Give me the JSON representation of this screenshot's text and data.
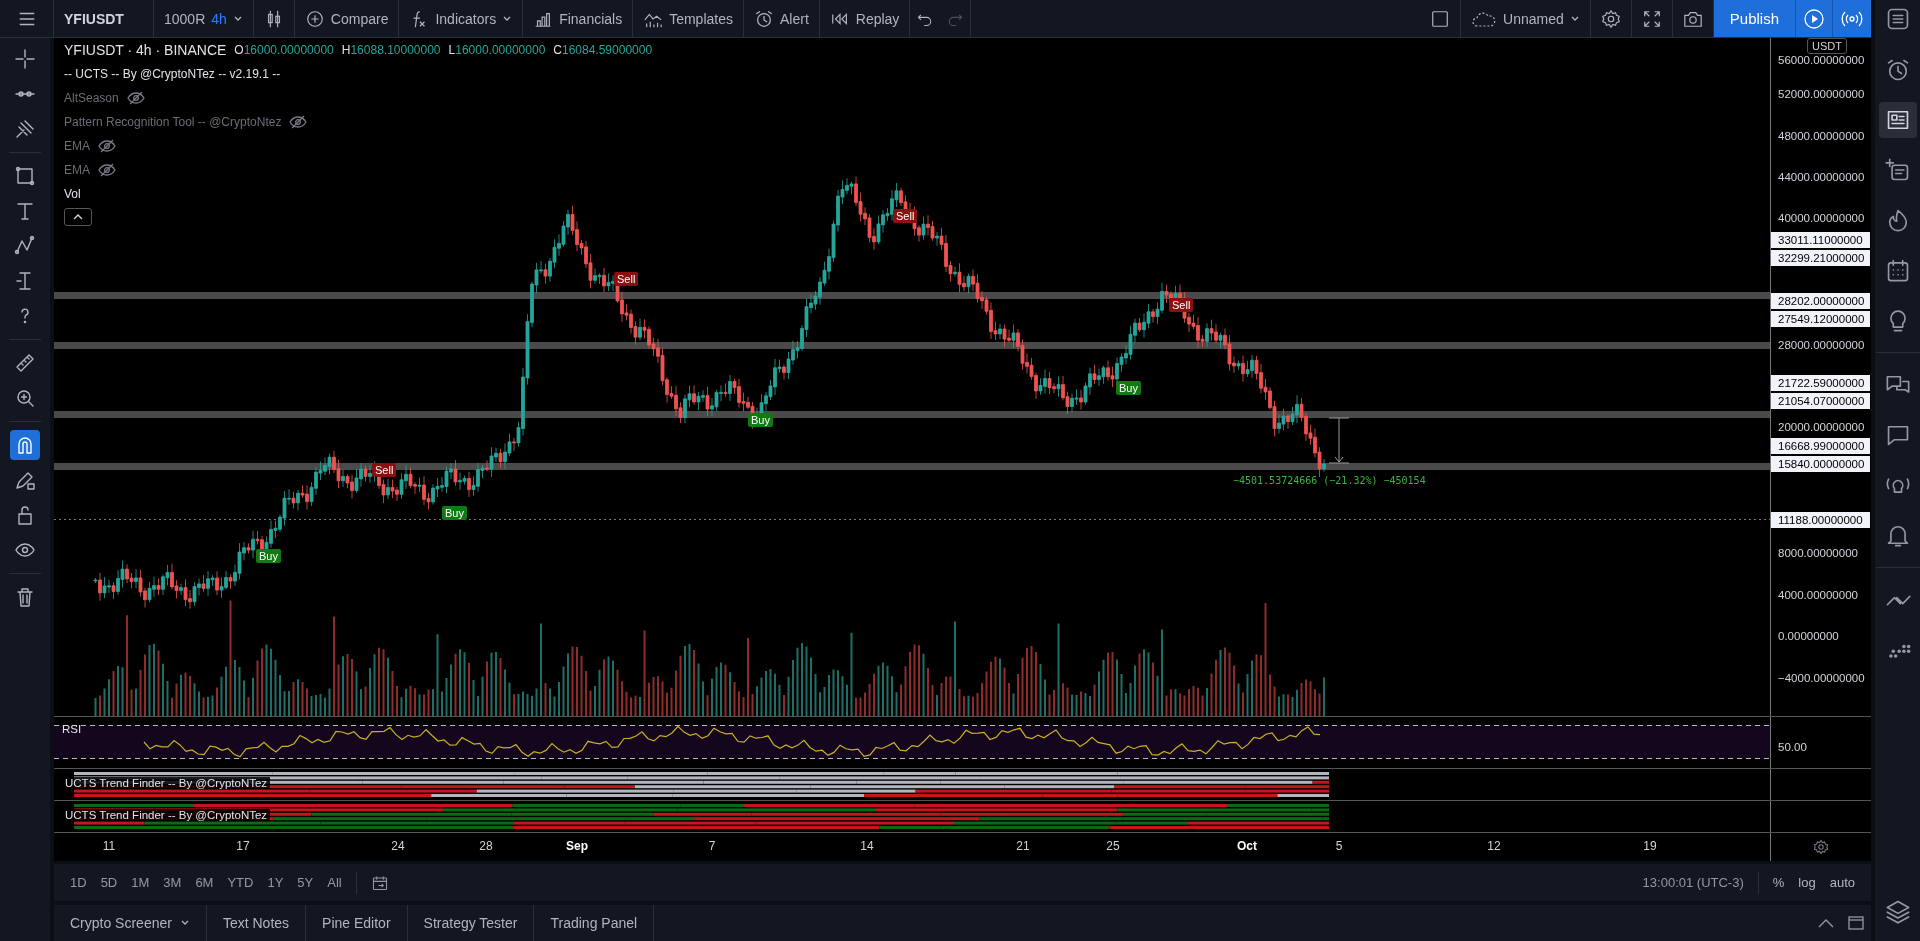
{
  "top_bar": {
    "symbol": "YFIUSDT",
    "intervals": [
      {
        "label": "1000R",
        "selected": false
      },
      {
        "label": "4h",
        "selected": true
      }
    ],
    "tools": [
      {
        "label": "Compare"
      },
      {
        "label": "Indicators",
        "dropdown": true
      },
      {
        "label": "Financials"
      },
      {
        "label": "Templates"
      },
      {
        "label": "Alert"
      },
      {
        "label": "Replay"
      }
    ],
    "layout_name": "Unnamed",
    "publish": "Publish"
  },
  "left_toolbar": [
    {
      "selected": false
    },
    {
      "selected": false
    },
    {
      "selected": false
    },
    {
      "selected": false
    },
    {
      "selected": false
    },
    {
      "selected": false
    },
    {
      "selected": false
    },
    {
      "selected": false
    },
    {
      "selected": false
    },
    {
      "selected": false
    },
    {
      "selected": true
    },
    {
      "selected": false
    },
    {
      "selected": false
    },
    {
      "selected": false
    },
    {
      "selected": false
    }
  ],
  "legend": {
    "title": "YFIUSDT · 4h · BINANCE",
    "ohlc": [
      {
        "label": "O",
        "value": "16000.00000000"
      },
      {
        "label": "H",
        "value": "16088.10000000"
      },
      {
        "label": "L",
        "value": "16000.00000000"
      },
      {
        "label": "C",
        "value": "16084.59000000"
      }
    ],
    "indicators": [
      {
        "name": "-- UCTS -- By @CryptoNTez -- v2.19.1 --",
        "hidden": false
      },
      {
        "name": "AltSeason",
        "hidden": true
      },
      {
        "name": "Pattern Recognition Tool -- @CryptoNtez",
        "hidden": true
      },
      {
        "name": "EMA",
        "hidden": true
      },
      {
        "name": "EMA",
        "hidden": true
      },
      {
        "name": "Vol",
        "hidden": false
      }
    ]
  },
  "signals": [
    {
      "label": "Sell",
      "kind": "sell"
    },
    {
      "label": "Sell",
      "kind": "sell"
    },
    {
      "label": "Sell",
      "kind": "sell"
    },
    {
      "label": "Buy",
      "kind": "buy"
    },
    {
      "label": "Buy",
      "kind": "buy"
    },
    {
      "label": "Sell",
      "kind": "sell"
    },
    {
      "label": "Buy",
      "kind": "buy"
    },
    {
      "label": "Buy",
      "kind": "buy"
    }
  ],
  "measure": {
    "text": "−4501.53724666 (−21.32%) −450154"
  },
  "price_axis": {
    "currency": "USDT",
    "labels": [
      {
        "text": "56000.00000000",
        "highlighted": false
      },
      {
        "text": "52000.00000000",
        "highlighted": false
      },
      {
        "text": "48000.00000000",
        "highlighted": false
      },
      {
        "text": "44000.00000000",
        "highlighted": false
      },
      {
        "text": "40000.00000000",
        "highlighted": false
      },
      {
        "text": "33011.11000000",
        "highlighted": true
      },
      {
        "text": "32299.21000000",
        "highlighted": true
      },
      {
        "text": "28202.00000000",
        "highlighted": true
      },
      {
        "text": "27549.12000000",
        "highlighted": true
      },
      {
        "text": "28000.00000000",
        "highlighted": false
      },
      {
        "text": "21722.59000000",
        "highlighted": true
      },
      {
        "text": "21054.07000000",
        "highlighted": true
      },
      {
        "text": "20000.00000000",
        "highlighted": false
      },
      {
        "text": "16668.99000000",
        "highlighted": true
      },
      {
        "text": "15840.00000000",
        "highlighted": true
      },
      {
        "text": "11188.00000000",
        "highlighted": true
      },
      {
        "text": "8000.00000000",
        "highlighted": false
      },
      {
        "text": "4000.00000000",
        "highlighted": false
      },
      {
        "text": "0.00000000",
        "highlighted": false
      },
      {
        "text": "−4000.00000000",
        "highlighted": false
      }
    ]
  },
  "rsi": {
    "label": "RSI",
    "axis_label": "50.00"
  },
  "trend_panes": [
    {
      "label": "UCTS Trend Finder -- By @CryptoNTez"
    },
    {
      "label": "UCTS Trend Finder -- By @CryptoNTez"
    }
  ],
  "time_axis": [
    {
      "label": "11",
      "kind": "day"
    },
    {
      "label": "17",
      "kind": "day"
    },
    {
      "label": "24",
      "kind": "day"
    },
    {
      "label": "28",
      "kind": "day"
    },
    {
      "label": "Sep",
      "kind": "month"
    },
    {
      "label": "7",
      "kind": "day"
    },
    {
      "label": "14",
      "kind": "day"
    },
    {
      "label": "21",
      "kind": "day"
    },
    {
      "label": "25",
      "kind": "day"
    },
    {
      "label": "Oct",
      "kind": "month"
    },
    {
      "label": "5",
      "kind": "day"
    },
    {
      "label": "12",
      "kind": "day"
    },
    {
      "label": "19",
      "kind": "day"
    }
  ],
  "range_bar": {
    "ranges": [
      "1D",
      "5D",
      "1M",
      "3M",
      "6M",
      "YTD",
      "1Y",
      "5Y",
      "All"
    ],
    "time": "13:00:01 (UTC-3)",
    "options": [
      "%",
      "log",
      "auto"
    ]
  },
  "bottom_tabs": [
    {
      "label": "Crypto Screener",
      "dropdown": true
    },
    {
      "label": "Text Notes",
      "dropdown": false
    },
    {
      "label": "Pine Editor",
      "dropdown": false
    },
    {
      "label": "Strategy Tester",
      "dropdown": false
    },
    {
      "label": "Trading Panel",
      "dropdown": false
    }
  ],
  "right_sidebar": [
    {
      "selected": false
    },
    {
      "selected": false
    },
    {
      "selected": true
    },
    {
      "selected": false
    },
    {
      "selected": false
    },
    {
      "selected": false
    },
    {
      "selected": false
    },
    {
      "selected": false
    },
    {
      "selected": false
    },
    {
      "selected": false
    },
    {
      "selected": false
    },
    {
      "selected": false
    },
    {
      "selected": false
    },
    {
      "selected": false
    }
  ]
}
